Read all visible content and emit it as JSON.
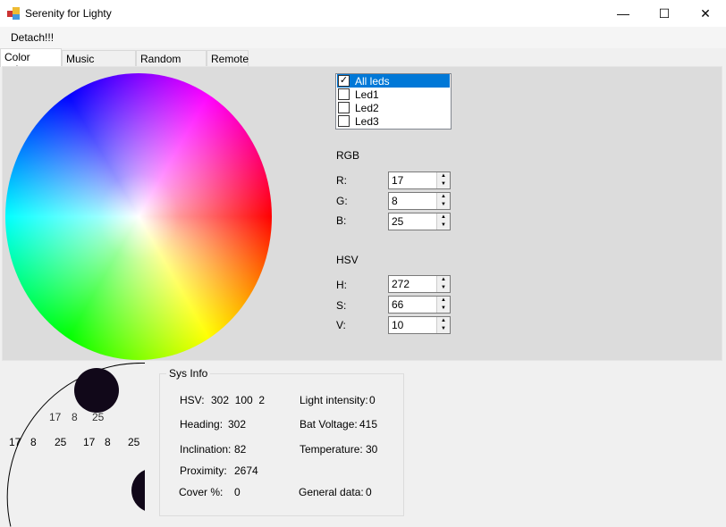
{
  "window": {
    "title": "Serenity for Lighty",
    "minimize": "—",
    "maximize": "☐",
    "close": "✕"
  },
  "menu": {
    "detach": "Detach!!!"
  },
  "tabs": [
    {
      "label": "Color select"
    },
    {
      "label": "Music equalizer"
    },
    {
      "label": "Random color"
    },
    {
      "label": "Remote"
    }
  ],
  "leds": [
    {
      "label": "All leds",
      "checked": true
    },
    {
      "label": "Led1",
      "checked": false
    },
    {
      "label": "Led2",
      "checked": false
    },
    {
      "label": "Led3",
      "checked": false
    }
  ],
  "rgb": {
    "title": "RGB",
    "r_label": "R:",
    "r": "17",
    "g_label": "G:",
    "g": "8",
    "b_label": "B:",
    "b": "25"
  },
  "hsv": {
    "title": "HSV",
    "h_label": "H:",
    "h": "272",
    "s_label": "S:",
    "s": "66",
    "v_label": "V:",
    "v": "10"
  },
  "preview": {
    "values": [
      "17",
      "8",
      "25"
    ],
    "circle_color": "#110819"
  },
  "sysinfo": {
    "title": "Sys Info",
    "hsv_label": "HSV:",
    "hsv_value": "302  100  2",
    "heading_label": "Heading:",
    "heading": "302",
    "inclination_label": "Inclination:",
    "inclination": "82",
    "proximity_label": "Proximity:",
    "proximity": "2674",
    "cover_label": "Cover %:",
    "cover": "0",
    "light_label": "Light intensity:",
    "light": "0",
    "bat_label": "Bat Voltage:",
    "bat": "415",
    "temp_label": "Temperature:",
    "temp": "30",
    "general_label": "General data:",
    "general": "0"
  }
}
